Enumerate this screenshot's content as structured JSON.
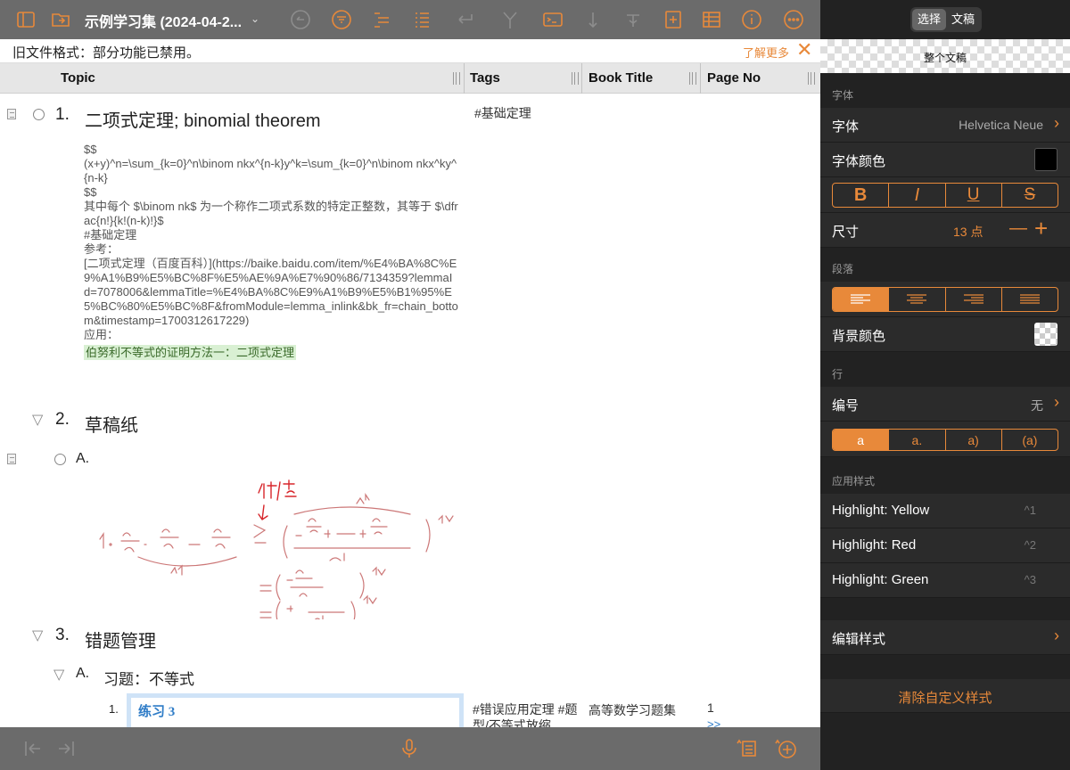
{
  "toolbar": {
    "doc_title": "示例学习集 (2024-04-2...",
    "icons": [
      "sidebar-icon",
      "folder-icon",
      "undo-icon",
      "filter-icon",
      "outline-icon",
      "list-icon",
      "return-icon",
      "branch-icon",
      "terminal-icon",
      "sort-icon",
      "text-size-icon",
      "add-row-icon",
      "table-icon",
      "info-icon",
      "more-icon"
    ]
  },
  "banner": {
    "text": "旧文件格式：部分功能已禁用。",
    "more": "了解更多",
    "close": "✕"
  },
  "columns": {
    "topic": "Topic",
    "tags": "Tags",
    "book_title": "Book Title",
    "page_no": "Page No"
  },
  "outline": {
    "row1": {
      "num": "1.",
      "title": "二项式定理; binomial theorem",
      "tag": "#基础定理",
      "note_lines": [
        "$$",
        "(x+y)^n=\\sum_{k=0}^n\\binom nkx^{n-k}y^k=\\sum_{k=0}^n\\binom nkx^ky^{n-k}",
        "$$",
        "其中每个 $\\binom nk$ 为一个称作二项式系数的特定正整数，其等于 $\\dfrac{n!}{k!(n-k)!}$",
        "#基础定理",
        "参考：",
        "[二项式定理（百度百科）](https://baike.baidu.com/item/%E4%BA%8C%E9%A1%B9%E5%BC%8F%E5%AE%9A%E7%90%86/7134359?lemmaId=7078006&lemmaTitle=%E4%BA%8C%E9%A1%B9%E5%B1%95%E5%BC%80%E5%BC%8F&fromModule=lemma_inlink&bk_fr=chain_bottom&timestamp=1700312617229)",
        "应用："
      ],
      "highlight": "伯努利不等式的证明方法一：二项式定理"
    },
    "row2": {
      "num": "2.",
      "title": "草稿纸"
    },
    "row2a": {
      "num": "A."
    },
    "row3": {
      "num": "3.",
      "title": "错题管理"
    },
    "row3a": {
      "num": "A.",
      "title": "习题：不等式"
    },
    "row3a1": {
      "num": "1.",
      "image_title": "练习 3",
      "tags": "#错误应用定理 #题型/不等式放缩",
      "book_title": "高等数学习题集",
      "page_no": "1",
      "page_link": ">>"
    }
  },
  "panel": {
    "seg_select": "选择",
    "seg_draft": "文稿",
    "scope": "整个文稿",
    "font_section": "字体",
    "font_label": "字体",
    "font_value": "Helvetica Neue",
    "font_color_label": "字体颜色",
    "font_color": "#000000",
    "styles": [
      "B",
      "I",
      "U",
      "S"
    ],
    "size_label": "尺寸",
    "size_value": "13 点",
    "paragraph_section": "段落",
    "bg_color_label": "背景颜色",
    "row_section": "行",
    "numbering_label": "编号",
    "numbering_value": "无",
    "numbering_styles": [
      "a",
      "a.",
      "a)",
      "(a)"
    ],
    "applied_section": "应用样式",
    "highlights": [
      {
        "label": "Highlight: Yellow",
        "key": "^1"
      },
      {
        "label": "Highlight: Red",
        "key": "^2"
      },
      {
        "label": "Highlight: Green",
        "key": "^3"
      }
    ],
    "edit_styles": "编辑样式",
    "clear_styles": "清除自定义样式"
  },
  "colors": {
    "accent": "#e8893a",
    "toolbar_bg": "#6b6b6b",
    "panel_bg": "#222222"
  }
}
